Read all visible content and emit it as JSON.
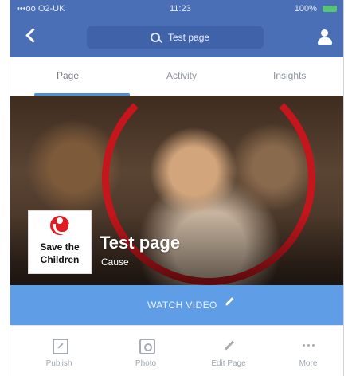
{
  "status_bar": {
    "carrier": "•••oo O2-UK",
    "time": "11:23",
    "battery": "100%"
  },
  "nav": {
    "search_text": "Test page"
  },
  "tabs": [
    {
      "label": "Page"
    },
    {
      "label": "Activity"
    },
    {
      "label": "Insights"
    }
  ],
  "cover": {
    "logo_line1": "Save the",
    "logo_line2": "Children",
    "page_name": "Test page",
    "page_category": "Cause"
  },
  "watch_button": {
    "label": "WATCH VIDEO"
  },
  "actions": [
    {
      "label": "Publish",
      "icon": "publish-icon"
    },
    {
      "label": "Photo",
      "icon": "photo-icon"
    },
    {
      "label": "Edit Page",
      "icon": "edit-icon"
    },
    {
      "label": "More",
      "icon": "more-icon"
    }
  ],
  "colors": {
    "header_blue": "#4a6fb7",
    "watch_blue": "#5f9de7",
    "ring_red": "#c4161c"
  }
}
